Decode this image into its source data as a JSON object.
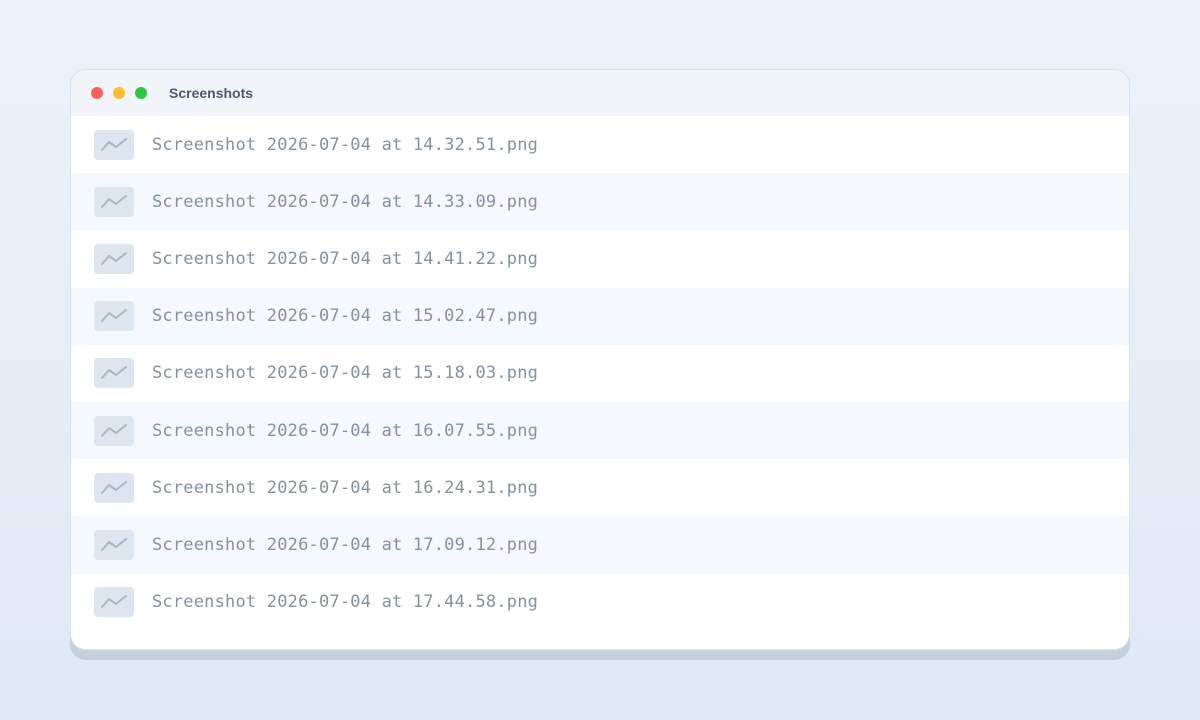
{
  "window": {
    "title": "Screenshots",
    "traffic_lights": {
      "close_color": "#ff5f57",
      "minimize_color": "#febc2e",
      "zoom_color": "#28c840"
    }
  },
  "files": [
    {
      "name": "Screenshot 2026-07-04 at 14.32.51.png",
      "icon": "image-thumbnail-icon"
    },
    {
      "name": "Screenshot 2026-07-04 at 14.33.09.png",
      "icon": "image-thumbnail-icon"
    },
    {
      "name": "Screenshot 2026-07-04 at 14.41.22.png",
      "icon": "image-thumbnail-icon"
    },
    {
      "name": "Screenshot 2026-07-04 at 15.02.47.png",
      "icon": "image-thumbnail-icon"
    },
    {
      "name": "Screenshot 2026-07-04 at 15.18.03.png",
      "icon": "image-thumbnail-icon"
    },
    {
      "name": "Screenshot 2026-07-04 at 16.07.55.png",
      "icon": "image-thumbnail-icon"
    },
    {
      "name": "Screenshot 2026-07-04 at 16.24.31.png",
      "icon": "image-thumbnail-icon"
    },
    {
      "name": "Screenshot 2026-07-04 at 17.09.12.png",
      "icon": "image-thumbnail-icon"
    },
    {
      "name": "Screenshot 2026-07-04 at 17.44.58.png",
      "icon": "image-thumbnail-icon"
    }
  ]
}
